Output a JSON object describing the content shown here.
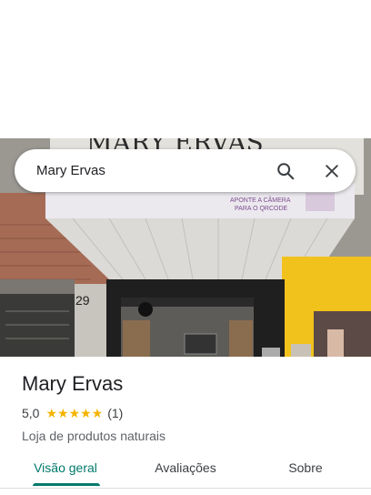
{
  "search": {
    "query": "Mary Ervas"
  },
  "photo": {
    "sign_text": "MARY ERVAS",
    "banner_line1": "APONTE A CÂMERA",
    "banner_line2": "PARA O QRCODE",
    "door_number": "29"
  },
  "place": {
    "name": "Mary Ervas",
    "rating": "5,0",
    "stars": "★★★★★",
    "review_count": "(1)",
    "category": "Loja de produtos naturais"
  },
  "tabs": [
    {
      "label": "Visão geral",
      "selected": true
    },
    {
      "label": "Avaliações",
      "selected": false
    },
    {
      "label": "Sobre",
      "selected": false
    }
  ],
  "colors": {
    "accent": "#00796b",
    "stars": "#f5b400",
    "shop_wall": "#f1c21b"
  }
}
